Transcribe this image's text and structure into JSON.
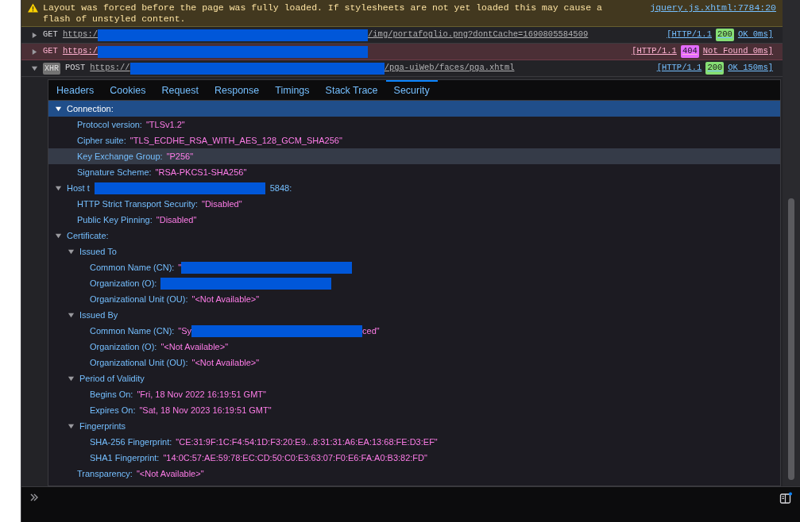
{
  "warning": {
    "message": "Layout was forced before the page was fully loaded. If stylesheets are not yet loaded this may cause a flash of unstyled content.",
    "source": "jquery.js.xhtml:7784:20"
  },
  "requests": [
    {
      "expanded": false,
      "error": false,
      "method": "GET",
      "url_start": "https:/",
      "url_end": "/img/portafoglio.png?dontCache=1690805584509",
      "protocol": "[HTTP/1.1",
      "code": "200",
      "status_rest": "OK 0ms]"
    },
    {
      "expanded": false,
      "error": true,
      "method": "GET",
      "url_start": "https:/",
      "protocol": "[HTTP/1.1",
      "code": "404",
      "status_rest": "Not Found 0ms]"
    },
    {
      "expanded": true,
      "error": false,
      "badge": "XHR",
      "method": "POST",
      "url_start": "https://",
      "url_end": "/pga-uiWeb/faces/pga.xhtml",
      "protocol": "[HTTP/1.1",
      "code": "200",
      "status_rest": "OK 150ms]"
    }
  ],
  "tabs": [
    {
      "label": "Headers",
      "selected": false
    },
    {
      "label": "Cookies",
      "selected": false
    },
    {
      "label": "Request",
      "selected": false
    },
    {
      "label": "Response",
      "selected": false
    },
    {
      "label": "Timings",
      "selected": false
    },
    {
      "label": "Stack Trace",
      "selected": false
    },
    {
      "label": "Security",
      "selected": true
    }
  ],
  "tree": [
    {
      "kind": "group",
      "label": "Connection:",
      "expanded": true,
      "selected": true,
      "hovered": false,
      "children": [
        {
          "kind": "entry",
          "key": "Protocol version:",
          "value": "\"TLSv1.2\"",
          "selected": false,
          "hovered": false
        },
        {
          "kind": "entry",
          "key": "Cipher suite:",
          "value": "\"TLS_ECDHE_RSA_WITH_AES_128_GCM_SHA256\"",
          "selected": false,
          "hovered": false
        },
        {
          "kind": "entry",
          "key": "Key Exchange Group:",
          "value": "\"P256\"",
          "selected": false,
          "hovered": true
        },
        {
          "kind": "entry",
          "key": "Signature Scheme:",
          "value": "\"RSA-PKCS1-SHA256\"",
          "selected": false,
          "hovered": false
        }
      ]
    },
    {
      "kind": "group",
      "label": "Host t",
      "label_end": "5848:",
      "redacted": true,
      "expanded": true,
      "selected": false,
      "hovered": false,
      "children": [
        {
          "kind": "entry",
          "key": "HTTP Strict Transport Security:",
          "value": "\"Disabled\"",
          "selected": false,
          "hovered": false
        },
        {
          "kind": "entry",
          "key": "Public Key Pinning:",
          "value": "\"Disabled\"",
          "selected": false,
          "hovered": false
        }
      ]
    },
    {
      "kind": "group",
      "label": "Certificate:",
      "expanded": true,
      "selected": false,
      "hovered": false,
      "children": [
        {
          "kind": "group",
          "label": "Issued To",
          "expanded": true,
          "selected": false,
          "hovered": false,
          "children": [
            {
              "kind": "entry",
              "key": "Common Name (CN):",
              "value": "\"",
              "redacted": true,
              "selected": false,
              "hovered": false
            },
            {
              "kind": "entry",
              "key": "Organization (O):",
              "redacted": true,
              "selected": false,
              "hovered": false
            },
            {
              "kind": "entry",
              "key": "Organizational Unit (OU):",
              "value": "\"<Not Available>\"",
              "selected": false,
              "hovered": false
            }
          ]
        },
        {
          "kind": "group",
          "label": "Issued By",
          "expanded": true,
          "selected": false,
          "hovered": false,
          "children": [
            {
              "kind": "entry",
              "key": "Common Name (CN):",
              "value": "\"Sy",
              "value_end": "ced\"",
              "redacted": true,
              "selected": false,
              "hovered": false
            },
            {
              "kind": "entry",
              "key": "Organization (O):",
              "value": "\"<Not Available>\"",
              "selected": false,
              "hovered": false
            },
            {
              "kind": "entry",
              "key": "Organizational Unit (OU):",
              "value": "\"<Not Available>\"",
              "selected": false,
              "hovered": false
            }
          ]
        },
        {
          "kind": "group",
          "label": "Period of Validity",
          "expanded": true,
          "selected": false,
          "hovered": false,
          "children": [
            {
              "kind": "entry",
              "key": "Begins On:",
              "value": "\"Fri, 18 Nov 2022 16:19:51 GMT\"",
              "selected": false,
              "hovered": false
            },
            {
              "kind": "entry",
              "key": "Expires On:",
              "value": "\"Sat, 18 Nov 2023 16:19:51 GMT\"",
              "selected": false,
              "hovered": false
            }
          ]
        },
        {
          "kind": "group",
          "label": "Fingerprints",
          "expanded": true,
          "selected": false,
          "hovered": false,
          "children": [
            {
              "kind": "entry",
              "key": "SHA-256 Fingerprint:",
              "value": "\"CE:31:9F:1C:F4:54:1D:F3:20:E9...8:31:31:A6:EA:13:68:FE:D3:EF\"",
              "selected": false,
              "hovered": false
            },
            {
              "kind": "entry",
              "key": "SHA1 Fingerprint:",
              "value": "\"14:0C:57:AE:59:78:EC:CD:50:C0:E3:63:07:F0:E6:FA:A0:B3:82:FD\"",
              "selected": false,
              "hovered": false
            }
          ]
        },
        {
          "kind": "entry",
          "key": "Transparency:",
          "value": "\"<Not Available>\"",
          "selected": false,
          "hovered": false
        }
      ]
    }
  ]
}
